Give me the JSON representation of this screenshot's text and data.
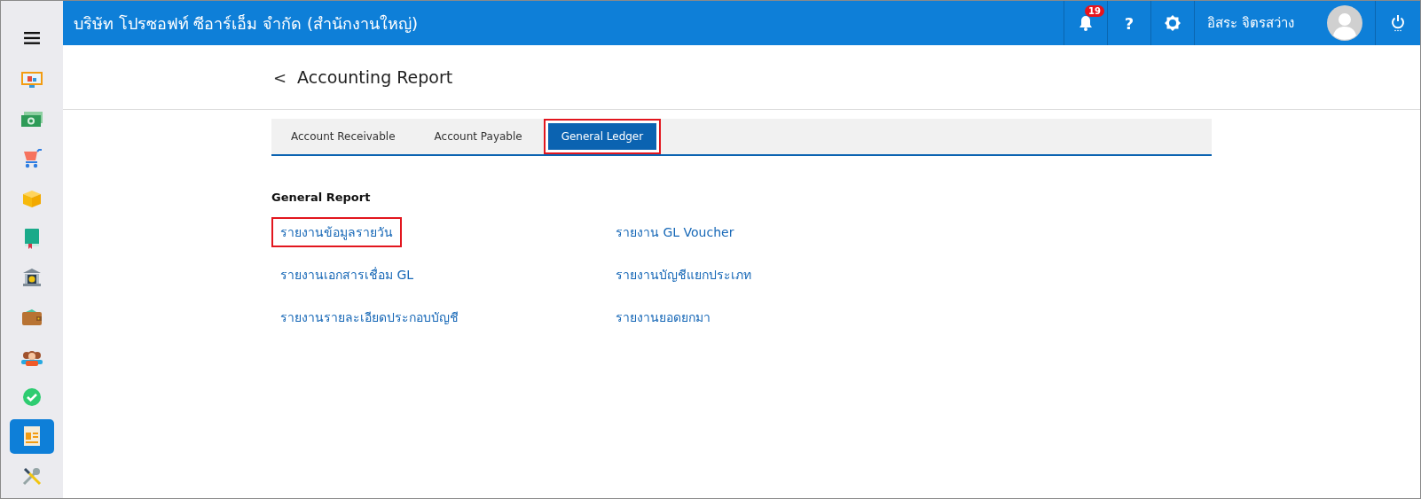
{
  "header": {
    "company": "บริษัท โปรซอฟท์ ซีอาร์เอ็ม จำกัด (สำนักงานใหญ่)",
    "notification_count": "19",
    "help": "?",
    "user_name": "อิสระ จิตรสว่าง"
  },
  "sidebar": {
    "items": [
      {
        "selected": false
      },
      {
        "selected": false
      },
      {
        "selected": false
      },
      {
        "selected": false
      },
      {
        "selected": false
      },
      {
        "selected": false
      },
      {
        "selected": false
      },
      {
        "selected": false
      },
      {
        "selected": false
      },
      {
        "selected": true
      },
      {
        "selected": false
      }
    ]
  },
  "page": {
    "back": "<",
    "title": "Accounting Report"
  },
  "tabs": [
    {
      "label": "Account Receivable",
      "selected": false,
      "highlighted": false
    },
    {
      "label": "Account Payable",
      "selected": false,
      "highlighted": false
    },
    {
      "label": "General Ledger",
      "selected": true,
      "highlighted": true
    }
  ],
  "section": {
    "title": "General Report",
    "links": [
      {
        "label": "รายงานข้อมูลรายวัน",
        "highlighted": true
      },
      {
        "label": "รายงาน GL Voucher",
        "highlighted": false
      },
      {
        "label": "รายงานเอกสารเชื่อม GL",
        "highlighted": false
      },
      {
        "label": "รายงานบัญชีแยกประเภท",
        "highlighted": false
      },
      {
        "label": "รายงานรายละเอียดประกอบบัญชี",
        "highlighted": false
      },
      {
        "label": "รายงานยอดยกมา",
        "highlighted": false
      }
    ]
  }
}
